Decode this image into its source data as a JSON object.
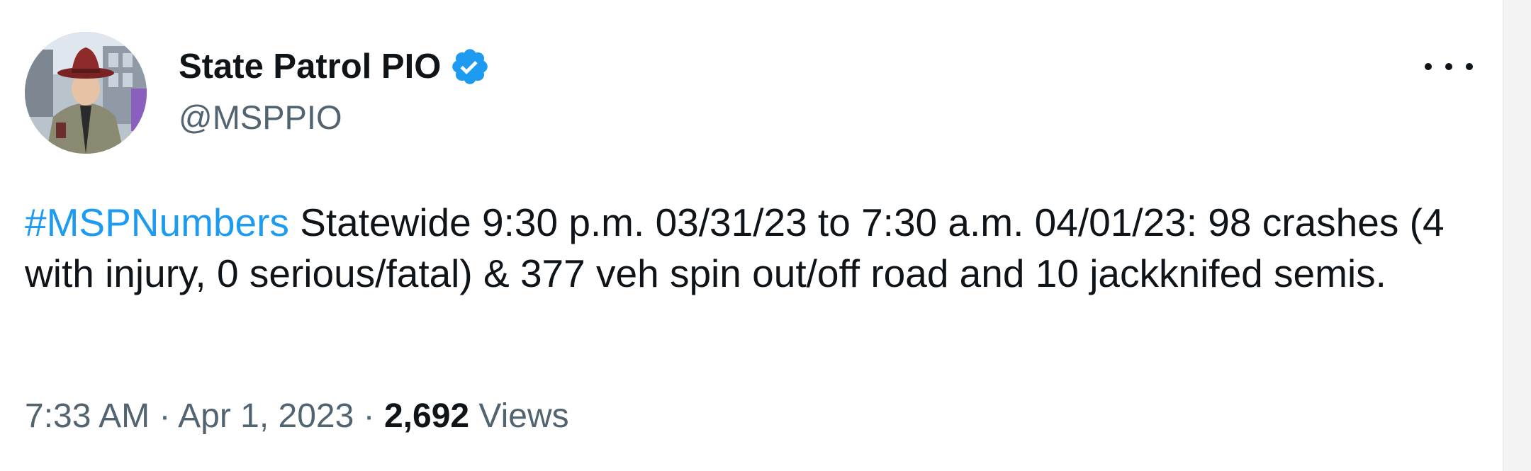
{
  "author": {
    "display_name": "State Patrol PIO",
    "handle": "@MSPPIO",
    "verified_icon": "verified-badge-icon",
    "verified_color": "#1d9bf0"
  },
  "menu": {
    "icon": "more-options-icon"
  },
  "tweet": {
    "hashtag": "#MSPNumbers",
    "text": " Statewide 9:30 p.m. 03/31/23 to 7:30 a.m. 04/01/23: 98 crashes (4 with injury, 0 serious/fatal) & 377 veh spin out/off road and 10 jackknifed semis.",
    "hashtag_color": "#1d9bf0"
  },
  "meta": {
    "time": "7:33 AM",
    "separator": " · ",
    "date": "Apr 1, 2023",
    "separator2": " · ",
    "views_count": "2,692",
    "views_label": " Views"
  }
}
